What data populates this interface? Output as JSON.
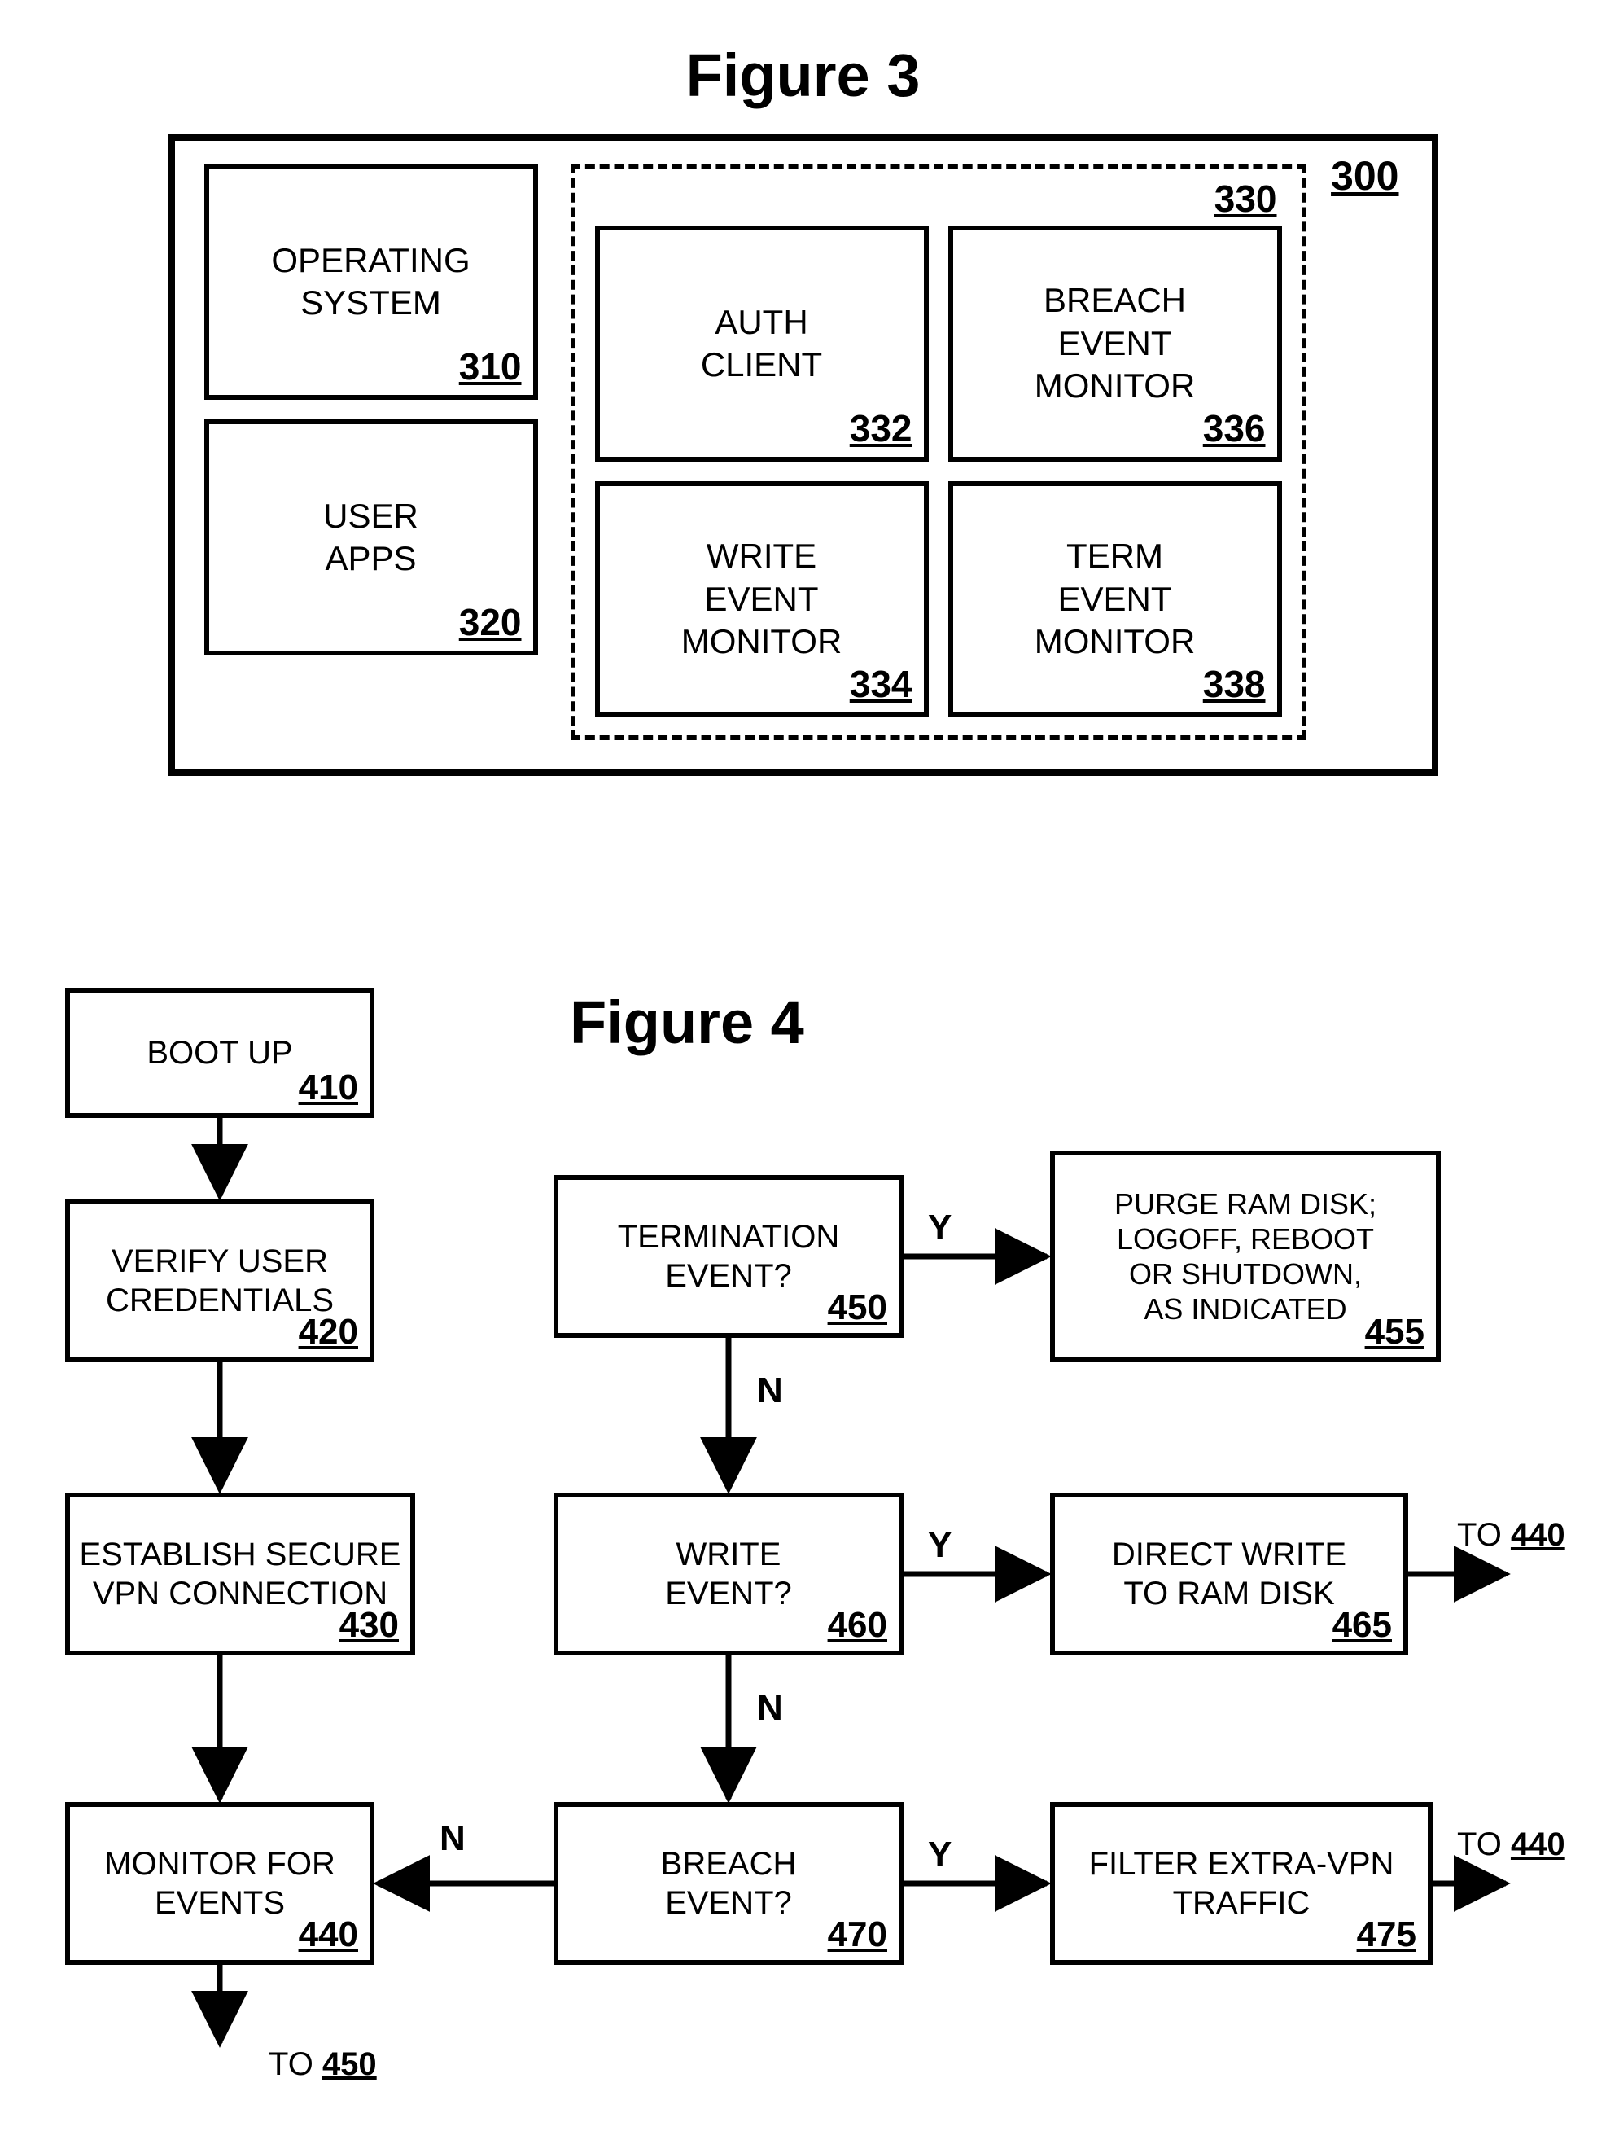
{
  "fig3": {
    "title": "Figure 3",
    "outer_ref": "300",
    "dashed_ref": "330",
    "boxes": {
      "os": {
        "label": "OPERATING\nSYSTEM",
        "ref": "310"
      },
      "apps": {
        "label": "USER\nAPPS",
        "ref": "320"
      },
      "auth": {
        "label": "AUTH\nCLIENT",
        "ref": "332"
      },
      "write": {
        "label": "WRITE\nEVENT\nMONITOR",
        "ref": "334"
      },
      "breach": {
        "label": "BREACH\nEVENT\nMONITOR",
        "ref": "336"
      },
      "term": {
        "label": "TERM\nEVENT\nMONITOR",
        "ref": "338"
      }
    }
  },
  "fig4": {
    "title": "Figure 4",
    "boxes": {
      "b410": {
        "label": "BOOT UP",
        "ref": "410"
      },
      "b420": {
        "label": "VERIFY USER\nCREDENTIALS",
        "ref": "420"
      },
      "b430": {
        "label": "ESTABLISH SECURE\nVPN CONNECTION",
        "ref": "430"
      },
      "b440": {
        "label": "MONITOR FOR\nEVENTS",
        "ref": "440"
      },
      "b450": {
        "label": "TERMINATION\nEVENT?",
        "ref": "450"
      },
      "b455": {
        "label": "PURGE RAM DISK;\nLOGOFF, REBOOT\nOR SHUTDOWN,\nAS INDICATED",
        "ref": "455"
      },
      "b460": {
        "label": "WRITE\nEVENT?",
        "ref": "460"
      },
      "b465": {
        "label": "DIRECT WRITE\nTO RAM DISK",
        "ref": "465"
      },
      "b470": {
        "label": "BREACH\nEVENT?",
        "ref": "470"
      },
      "b475": {
        "label": "FILTER EXTRA-VPN\nTRAFFIC",
        "ref": "475"
      }
    },
    "labels": {
      "Y": "Y",
      "N": "N",
      "to440": "TO 440",
      "to450": "TO 450"
    }
  }
}
